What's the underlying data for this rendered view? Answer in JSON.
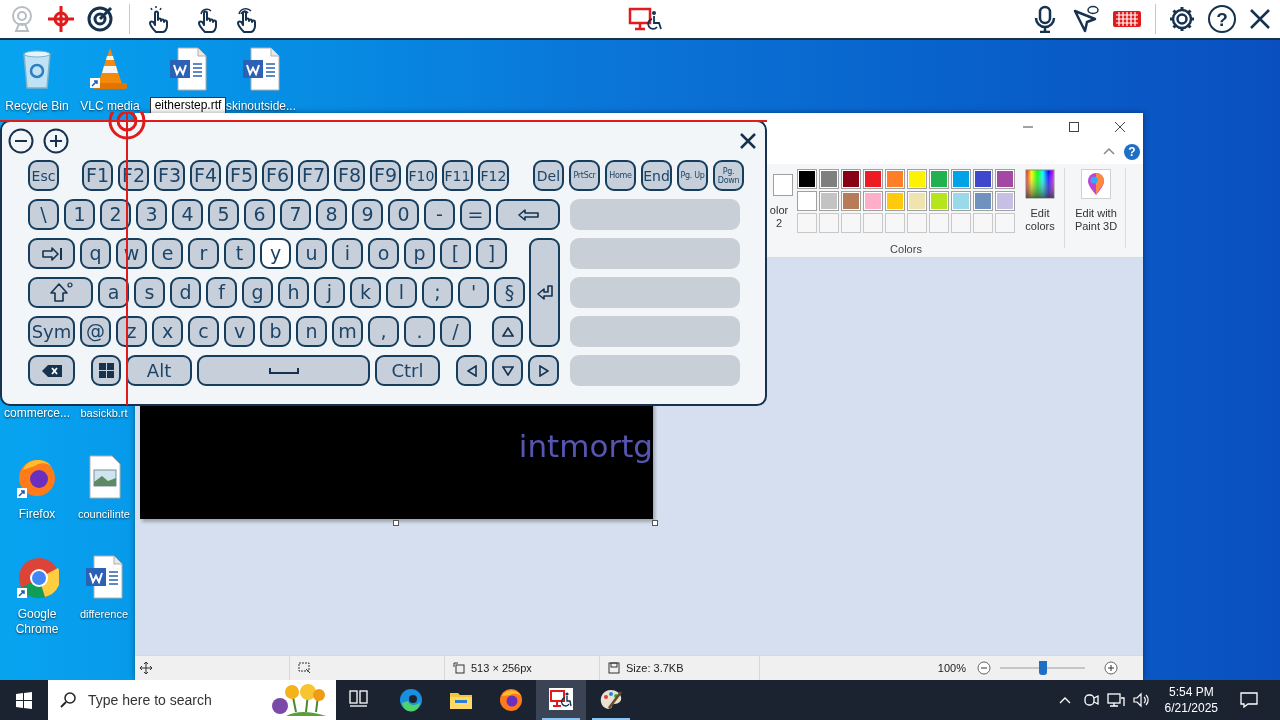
{
  "toolbar": {
    "help_glyph": "?"
  },
  "desktop_icons": [
    {
      "kind": "recycle",
      "label": "Recycle Bin",
      "renaming": false
    },
    {
      "kind": "vlc",
      "label": "VLC media",
      "renaming": false
    },
    {
      "kind": "word",
      "label": "eitherstep.rtf",
      "renaming": true
    },
    {
      "kind": "word",
      "label": "skinoutside...",
      "renaming": false
    },
    {
      "kind": "covered",
      "label": "commerce...",
      "renaming": false
    },
    {
      "kind": "covered",
      "label": "basickb.rt",
      "renaming": false
    },
    {
      "kind": "firefox",
      "label": "Firefox",
      "renaming": false
    },
    {
      "kind": "image",
      "label": "councilinte",
      "renaming": false
    },
    {
      "kind": "chrome",
      "label": "Google Chrome",
      "renaming": false
    },
    {
      "kind": "word",
      "label": "difference",
      "renaming": false
    }
  ],
  "paint": {
    "help_glyph": "?",
    "color2_label": "olor 2",
    "palette": [
      {
        "color": "#000000"
      },
      {
        "color": "#7f7f7f"
      },
      {
        "color": "#880015"
      },
      {
        "color": "#ed1c24"
      },
      {
        "color": "#ff7f27"
      },
      {
        "color": "#fff200"
      },
      {
        "color": "#22b14c"
      },
      {
        "color": "#00a2e8"
      },
      {
        "color": "#3f48cc"
      },
      {
        "color": "#a349a4"
      },
      {
        "color": "#ffffff"
      },
      {
        "color": "#c3c3c3"
      },
      {
        "color": "#b97a57"
      },
      {
        "color": "#ffaec9"
      },
      {
        "color": "#ffc90e"
      },
      {
        "color": "#efe4b0"
      },
      {
        "color": "#b5e61d"
      },
      {
        "color": "#99d9ea"
      },
      {
        "color": "#7092be"
      },
      {
        "color": "#c8bfe7"
      }
    ],
    "colors_label": "Colors",
    "edit_colors": "Edit colors",
    "paint3d": "Edit with Paint 3D",
    "canvas_text": "intmortg",
    "status": {
      "dimensions": "513 × 256px",
      "size": "Size: 3.7KB",
      "zoom": "100%",
      "zoom_slider": {
        "level": 0.5
      }
    }
  },
  "keyboard": {
    "rows": [
      {
        "keys": [
          {
            "kind": "medium",
            "label": "Esc",
            "pressed": false
          },
          {
            "kind": "key",
            "label": "F1",
            "pressed": false
          },
          {
            "kind": "key",
            "label": "F2",
            "pressed": false
          },
          {
            "kind": "key",
            "label": "F3",
            "pressed": false
          },
          {
            "kind": "key",
            "label": "F4",
            "pressed": false
          },
          {
            "kind": "key",
            "label": "F5",
            "pressed": false
          },
          {
            "kind": "key",
            "label": "F6",
            "pressed": false
          },
          {
            "kind": "key",
            "label": "F7",
            "pressed": false
          },
          {
            "kind": "key",
            "label": "F8",
            "pressed": false
          },
          {
            "kind": "key",
            "label": "F9",
            "pressed": false
          },
          {
            "kind": "medium",
            "label": "F10",
            "pressed": false
          },
          {
            "kind": "medium",
            "label": "F11",
            "pressed": false
          },
          {
            "kind": "medium",
            "label": "F12",
            "pressed": false
          },
          {
            "kind": "medium",
            "label": "Del",
            "pressed": false
          },
          {
            "kind": "small",
            "label": "PrtScr",
            "pressed": false
          },
          {
            "kind": "small",
            "label": "Home",
            "pressed": false
          },
          {
            "kind": "medium",
            "label": "End",
            "pressed": false
          },
          {
            "kind": "small",
            "label": "Pg. Up",
            "pressed": false
          },
          {
            "kind": "small",
            "label": "Pg. Down",
            "pressed": false
          }
        ]
      },
      {
        "keys": [
          {
            "kind": "key",
            "label": "\\",
            "pressed": false
          },
          {
            "kind": "key",
            "label": "1",
            "pressed": false
          },
          {
            "kind": "key",
            "label": "2",
            "pressed": false
          },
          {
            "kind": "key",
            "label": "3",
            "pressed": false
          },
          {
            "kind": "key",
            "label": "4",
            "pressed": false
          },
          {
            "kind": "key",
            "label": "5",
            "pressed": false
          },
          {
            "kind": "key",
            "label": "6",
            "pressed": false
          },
          {
            "kind": "key",
            "label": "7",
            "pressed": false
          },
          {
            "kind": "key",
            "label": "8",
            "pressed": false
          },
          {
            "kind": "key",
            "label": "9",
            "pressed": false
          },
          {
            "kind": "key",
            "label": "0",
            "pressed": false
          },
          {
            "kind": "key",
            "label": "-",
            "pressed": false
          },
          {
            "kind": "key",
            "label": "=",
            "pressed": false
          },
          {
            "kind": "backspace",
            "pressed": false
          }
        ]
      },
      {
        "keys": [
          {
            "kind": "tab",
            "pressed": false
          },
          {
            "kind": "key",
            "label": "q",
            "pressed": false
          },
          {
            "kind": "key",
            "label": "w",
            "pressed": false
          },
          {
            "kind": "key",
            "label": "e",
            "pressed": false
          },
          {
            "kind": "key",
            "label": "r",
            "pressed": false
          },
          {
            "kind": "key",
            "label": "t",
            "pressed": false
          },
          {
            "kind": "key",
            "label": "y",
            "pressed": true
          },
          {
            "kind": "key",
            "label": "u",
            "pressed": false
          },
          {
            "kind": "key",
            "label": "i",
            "pressed": false
          },
          {
            "kind": "key",
            "label": "o",
            "pressed": false
          },
          {
            "kind": "key",
            "label": "p",
            "pressed": false
          },
          {
            "kind": "key",
            "label": "[",
            "pressed": false
          },
          {
            "kind": "key",
            "label": "]",
            "pressed": false
          },
          {
            "kind": "enter",
            "pressed": false
          }
        ]
      },
      {
        "keys": [
          {
            "kind": "shift",
            "pressed": false
          },
          {
            "kind": "key",
            "label": "a",
            "pressed": false
          },
          {
            "kind": "key",
            "label": "s",
            "pressed": false
          },
          {
            "kind": "key",
            "label": "d",
            "pressed": false
          },
          {
            "kind": "key",
            "label": "f",
            "pressed": false
          },
          {
            "kind": "key",
            "label": "g",
            "pressed": false
          },
          {
            "kind": "key",
            "label": "h",
            "pressed": false
          },
          {
            "kind": "key",
            "label": "j",
            "pressed": false
          },
          {
            "kind": "key",
            "label": "k",
            "pressed": false
          },
          {
            "kind": "key",
            "label": "l",
            "pressed": false
          },
          {
            "kind": "key",
            "label": ";",
            "pressed": false
          },
          {
            "kind": "key",
            "label": "'",
            "pressed": false
          },
          {
            "kind": "key",
            "label": "§",
            "pressed": false
          }
        ]
      },
      {
        "keys": [
          {
            "kind": "wide",
            "label": "Sym",
            "pressed": false
          },
          {
            "kind": "key",
            "label": "@",
            "pressed": false
          },
          {
            "kind": "key",
            "label": "z",
            "pressed": false
          },
          {
            "kind": "key",
            "label": "x",
            "pressed": false
          },
          {
            "kind": "key",
            "label": "c",
            "pressed": false
          },
          {
            "kind": "key",
            "label": "v",
            "pressed": false
          },
          {
            "kind": "key",
            "label": "b",
            "pressed": false
          },
          {
            "kind": "key",
            "label": "n",
            "pressed": false
          },
          {
            "kind": "key",
            "label": "m",
            "pressed": false
          },
          {
            "kind": "key",
            "label": ",",
            "pressed": false
          },
          {
            "kind": "key",
            "label": ".",
            "pressed": false
          },
          {
            "kind": "key",
            "label": "/",
            "pressed": false
          },
          {
            "kind": "up",
            "pressed": false
          }
        ]
      },
      {
        "keys": [
          {
            "kind": "erase",
            "pressed": false
          },
          {
            "kind": "windows",
            "pressed": false
          },
          {
            "kind": "alt",
            "label": "Alt",
            "pressed": false
          },
          {
            "kind": "space",
            "pressed": false
          },
          {
            "kind": "ctrl",
            "label": "Ctrl",
            "pressed": false
          },
          {
            "kind": "left",
            "pressed": false
          },
          {
            "kind": "down",
            "pressed": false
          },
          {
            "kind": "right",
            "pressed": false
          }
        ]
      }
    ]
  },
  "taskbar": {
    "search_placeholder": "Type here to search",
    "apps": [
      {
        "kind": "taskview",
        "running": false,
        "active": false
      },
      {
        "kind": "edge",
        "running": false,
        "active": false
      },
      {
        "kind": "explorer",
        "running": false,
        "active": false
      },
      {
        "kind": "firefox",
        "running": false,
        "active": false
      },
      {
        "kind": "access",
        "running": true,
        "active": true
      },
      {
        "kind": "paint",
        "running": true,
        "active": false
      }
    ],
    "time": "5:54 PM",
    "date": "6/21/2025"
  }
}
